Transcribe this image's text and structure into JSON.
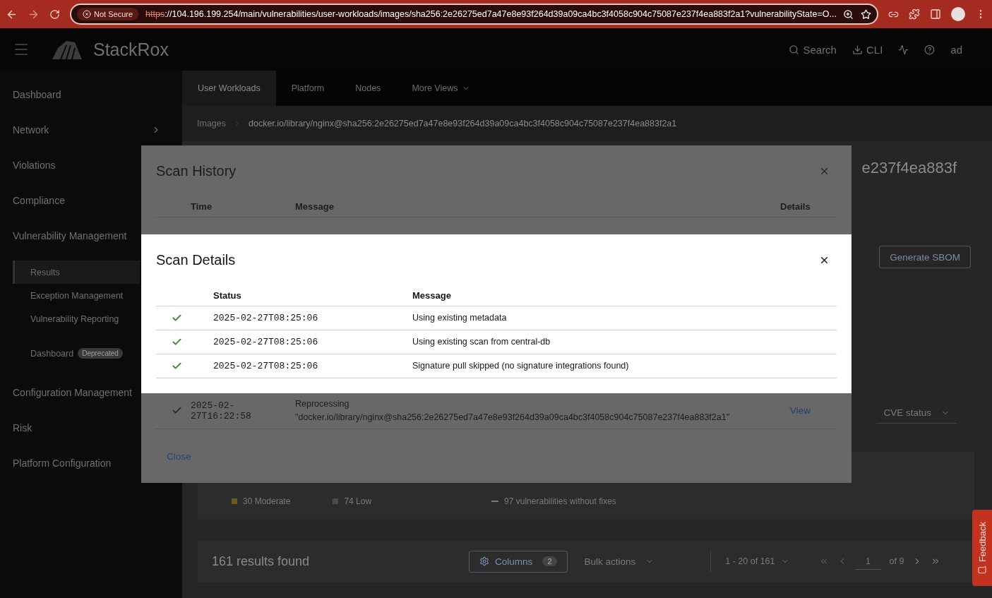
{
  "browser": {
    "security_badge": "Not Secure",
    "url_scheme": "https",
    "url_rest": "://104.196.199.254/main/vulnerabilities/user-workloads/images/sha256:2e26275ed7a47e8e93f264d39a09ca4bc3f4058c904c75087e237f4ea883f2a1?vulnerabilityState=O..."
  },
  "header": {
    "logo": "StackRox",
    "actions": [
      {
        "kind": "search",
        "label": "Search"
      },
      {
        "kind": "download",
        "label": "CLI"
      },
      {
        "kind": "pulse"
      },
      {
        "kind": "help"
      }
    ],
    "user": "ad"
  },
  "sidebar": {
    "items": [
      {
        "kind": "link",
        "label": "Dashboard"
      },
      {
        "kind": "expandable",
        "label": "Network"
      },
      {
        "kind": "link",
        "label": "Violations"
      },
      {
        "kind": "link",
        "label": "Compliance"
      },
      {
        "kind": "group",
        "label": "Vulnerability Management",
        "children": [
          {
            "label": "Results",
            "selected": true
          },
          {
            "label": "Exception Management",
            "selected": false
          },
          {
            "label": "Vulnerability Reporting",
            "selected": false
          },
          {
            "label": "Dashboard",
            "selected": false,
            "badge": "Deprecated"
          }
        ]
      },
      {
        "kind": "link",
        "label": "Configuration Management"
      },
      {
        "kind": "link",
        "label": "Risk"
      },
      {
        "kind": "link",
        "label": "Platform Configuration"
      }
    ]
  },
  "tabs": [
    {
      "label": "User Workloads",
      "selected": true,
      "kind": "tab"
    },
    {
      "label": "Platform",
      "selected": false,
      "kind": "tab"
    },
    {
      "label": "Nodes",
      "selected": false,
      "kind": "tab"
    },
    {
      "label": "More Views",
      "selected": false,
      "kind": "dropdown"
    }
  ],
  "breadcrumb": [
    "Images",
    "docker.io/library/nginx@sha256:2e26275ed7a47e8e93f264d39a09ca4bc3f4058c904c75087e237f4ea883f2a1"
  ],
  "page": {
    "title_fragment": "e237f4ea883f",
    "generate_button": "Generate SBOM",
    "filter": "CVE status",
    "severities": [
      {
        "label": "30 Moderate",
        "color": "#6b5a23"
      },
      {
        "label": "74 Low",
        "color": "#4a4a4a"
      }
    ],
    "fix_summary": "97 vulnerabilities without fixes",
    "results": "161 results found",
    "columns_button": {
      "label": "Columns",
      "count": "2"
    },
    "bulk_actions": "Bulk actions",
    "pagination": {
      "range": "1 - 20 of 161",
      "page": "1",
      "of": "of 9"
    }
  },
  "feedback": "Feedback",
  "scan_history": {
    "title": "Scan History",
    "columns": [
      "Time",
      "Message",
      "Details"
    ],
    "rows": [
      {
        "succeeded": true,
        "time": "2025-02-27T16:22:58",
        "message": "Reprocessing \"docker.io/library/nginx@sha256:2e26275ed7a47e8e93f264d39a09ca4bc3f4058c904c75087e237f4ea883f2a1\"",
        "details": "View"
      }
    ],
    "close": "Close"
  },
  "scan_details": {
    "title": "Scan Details",
    "columns": [
      "Status",
      "Message"
    ],
    "rows": [
      {
        "succeeded": true,
        "time": "2025-02-27T08:25:06",
        "message": "Using existing metadata"
      },
      {
        "succeeded": true,
        "time": "2025-02-27T08:25:06",
        "message": "Using existing scan from central-db"
      },
      {
        "succeeded": true,
        "time": "2025-02-27T08:25:06",
        "message": "Signature pull skipped (no signature integrations found)"
      }
    ]
  }
}
